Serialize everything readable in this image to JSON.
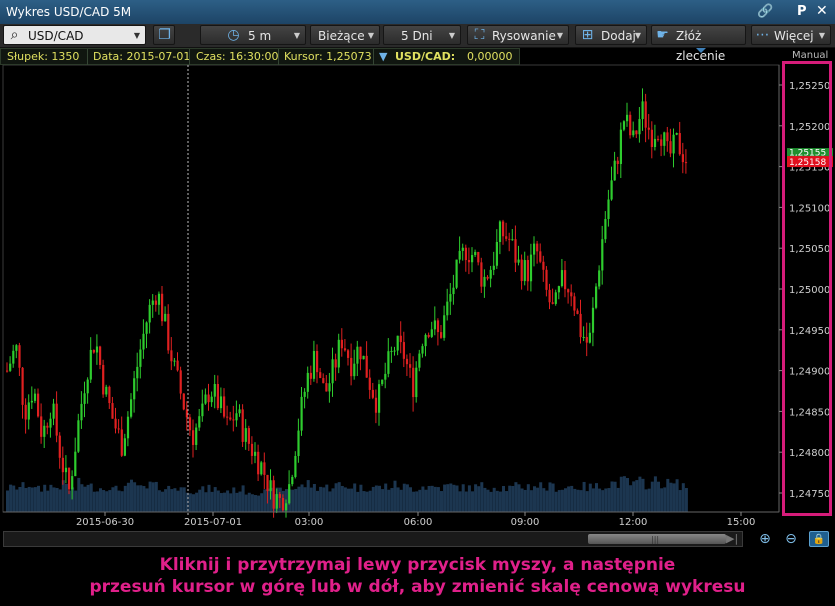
{
  "window": {
    "title": "Wykres USD/CAD 5M",
    "pin_label": "P",
    "close_label": "✕"
  },
  "toolbar": {
    "symbol": "USD/CAD",
    "interval": "5 m",
    "price_type": "Bieżące",
    "range": "5 Dni",
    "drawing": "Rysowanie",
    "add": "Dodaj",
    "order": "Złóż zlecenie",
    "more": "Więcej"
  },
  "info": {
    "bar": "Słupek: 1350",
    "date": "Data: 2015-07-01",
    "time": "Czas: 16:30:00",
    "cursor": "Kursor: 1,25073",
    "instrument": "USD/CAD:",
    "value": "0,00000"
  },
  "scale_mode": "Manual",
  "chart_data": {
    "type": "candlestick",
    "symbol": "USD/CAD",
    "interval": "5m",
    "y_range": [
      1.2472,
      1.2535
    ],
    "y_ticks": [
      "1,25250",
      "1,25200",
      "1,25150",
      "1,25100",
      "1,25050",
      "1,25000",
      "1,24950",
      "1,24900",
      "1,24850",
      "1,24800",
      "1,24750"
    ],
    "x_ticks": [
      "2015-06-30",
      "2015-07-01",
      "03:00",
      "06:00",
      "09:00",
      "12:00",
      "15:00"
    ],
    "last_price": "1,25158",
    "bid_label": "1,25155",
    "colors": {
      "up": "#2ecc2e",
      "down": "#e02020",
      "volume": "#1c3650",
      "grid": "#2a2a2a",
      "last": "#e0101e"
    },
    "close_path": [
      1.249,
      1.2493,
      1.2485,
      1.2488,
      1.2482,
      1.2486,
      1.248,
      1.2475,
      1.2483,
      1.249,
      1.2494,
      1.2488,
      1.2484,
      1.2481,
      1.2486,
      1.2492,
      1.2497,
      1.25,
      1.2495,
      1.249,
      1.2486,
      1.2482,
      1.2484,
      1.2488,
      1.2486,
      1.2483,
      1.2485,
      1.2482,
      1.248,
      1.2478,
      1.2475,
      1.2474,
      1.2476,
      1.2483,
      1.2489,
      1.2492,
      1.2487,
      1.249,
      1.2494,
      1.2491,
      1.2493,
      1.2489,
      1.2486,
      1.249,
      1.2493,
      1.2492,
      1.2488,
      1.2494,
      1.2496,
      1.2494,
      1.2498,
      1.2502,
      1.2505,
      1.2504,
      1.2501,
      1.2503,
      1.2507,
      1.2506,
      1.2503,
      1.2502,
      1.2505,
      1.25,
      1.2497,
      1.2501,
      1.25,
      1.2495,
      1.2493,
      1.2502,
      1.251,
      1.2515,
      1.2521,
      1.2518,
      1.2522,
      1.2519,
      1.252,
      1.2516,
      1.2518,
      1.2516
    ],
    "volumes": [
      0.55,
      0.6,
      0.7,
      0.5,
      0.62,
      0.58,
      0.66,
      0.5,
      0.72,
      0.6,
      0.55,
      0.64,
      0.5,
      0.6,
      0.7,
      0.52,
      0.68,
      0.6,
      0.55,
      0.58,
      0.5,
      0.45,
      0.48,
      0.52,
      0.4,
      0.45,
      0.5,
      0.42,
      0.38,
      0.4,
      0.44,
      0.5,
      0.55,
      0.6,
      0.7,
      0.62,
      0.58,
      0.66,
      0.6,
      0.64,
      0.55,
      0.6,
      0.58,
      0.62,
      0.66,
      0.6,
      0.55,
      0.62,
      0.6,
      0.58,
      0.64,
      0.6,
      0.55,
      0.58,
      0.62,
      0.6,
      0.58,
      0.55,
      0.6,
      0.62,
      0.66,
      0.58,
      0.6,
      0.55,
      0.62,
      0.6,
      0.58,
      0.6,
      0.7,
      0.75,
      0.8,
      0.7,
      0.78,
      0.74,
      0.8,
      0.72,
      0.7,
      0.66
    ]
  },
  "scroll_icons": {
    "zoom_in": "⊕",
    "zoom_out": "⊖",
    "lock": "🔒"
  },
  "hint": {
    "line1": "Kliknij i przytrzymaj lewy przycisk myszy, a następnie",
    "line2": "przesuń kursor w górę lub w dół, aby zmienić skalę cenową wykresu"
  }
}
